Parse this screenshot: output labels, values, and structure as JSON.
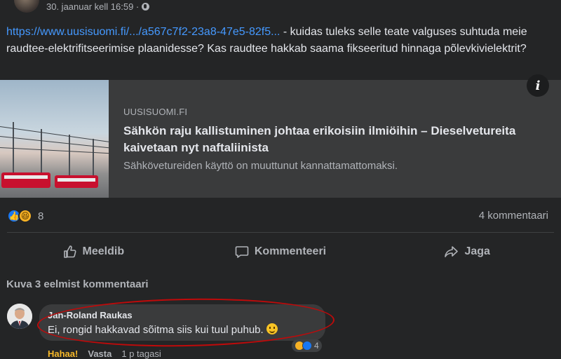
{
  "post": {
    "timestamp": "30. jaanuar kell 16:59 ·",
    "link_text": "https://www.uusisuomi.fi/.../a567c7f2-23a8-47e5-82f5...",
    "body_text": " - kuidas tuleks selle teate valguses suhtuda meie raudtee-elektrifitseerimise plaanidesse? Kas raudtee hakkab saama fikseeritud hinnaga põlevkivielektrit?",
    "privacy_icon": "globe-icon"
  },
  "preview": {
    "source": "UUSISUOMI.FI",
    "title": "Sähkön raju kallistuminen johtaa erikoisiin ilmiöihin – Dieselvetureita kaivetaan nyt naftaliinista",
    "description": "Sähkövetureiden käyttö on muuttunut kannattamattomaksi.",
    "info_label": "i"
  },
  "stats": {
    "reaction_icons": [
      "like-icon",
      "haha-icon"
    ],
    "reaction_count": "8",
    "comments_count": "4 kommentaari"
  },
  "actions": {
    "like": "Meeldib",
    "comment": "Kommenteeri",
    "share": "Jaga"
  },
  "comments": {
    "more_label": "Kuva 3 eelmist kommentaari",
    "items": [
      {
        "author": "Jan-Roland Raukas",
        "text": "Ei, rongid hakkavad sõitma siis kui tuul puhub.",
        "reaction_count": "4",
        "reaction_label": "Hahaa!",
        "reply_label": "Vasta",
        "time": "1 p tagasi"
      }
    ]
  },
  "colors": {
    "background": "#242526",
    "link": "#4599ff",
    "highlight": "#c00a0a",
    "haha": "#f7b928"
  }
}
